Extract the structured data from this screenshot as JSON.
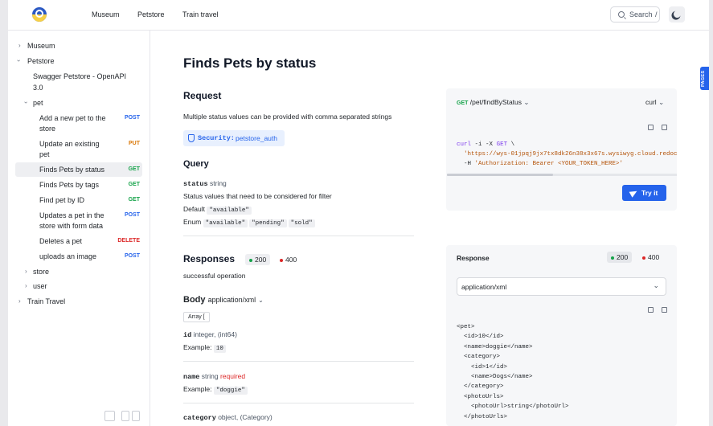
{
  "header": {
    "nav": [
      "Museum",
      "Petstore",
      "Train travel"
    ],
    "search": {
      "label": "Search",
      "shortcut": "/"
    }
  },
  "sidebar": {
    "museum": "Museum",
    "petstore": "Petstore",
    "petstore_doc": [
      "Swagger Petstore - OpenAPI",
      "3.0"
    ],
    "pet": "pet",
    "endpoints": [
      {
        "lines": [
          "Add a new pet to the",
          "store"
        ],
        "method": "POST"
      },
      {
        "lines": [
          "Update an existing",
          "pet"
        ],
        "method": "PUT"
      },
      {
        "lines": [
          "Finds Pets by status"
        ],
        "method": "GET",
        "active": true
      },
      {
        "lines": [
          "Finds Pets by tags"
        ],
        "method": "GET"
      },
      {
        "lines": [
          "Find pet by ID"
        ],
        "method": "GET"
      },
      {
        "lines": [
          "Updates a pet in the",
          "store with form data"
        ],
        "method": "POST"
      },
      {
        "lines": [
          "Deletes a pet"
        ],
        "method": "DELETE"
      },
      {
        "lines": [
          "uploads an image"
        ],
        "method": "POST"
      }
    ],
    "store": "store",
    "user": "user",
    "train_travel": "Train Travel"
  },
  "main": {
    "title": "Finds Pets by status",
    "request": {
      "heading": "Request",
      "description": "Multiple status values can be provided with comma separated strings",
      "security_label": "Security:",
      "security_value": "petstore_auth"
    },
    "query": {
      "heading": "Query",
      "param_name": "status",
      "param_type": "string",
      "param_desc": "Status values that need to be considered for filter",
      "default_label": "Default",
      "default_value": "\"available\"",
      "enum_label": "Enum",
      "enum_values": [
        "\"available\"",
        "\"pending\"",
        "\"sold\""
      ]
    },
    "responses": {
      "heading": "Responses",
      "codes": [
        "200",
        "400"
      ],
      "description": "successful operation",
      "body_label": "Body",
      "body_type": "application/xml",
      "array_label": "Array [",
      "fields": [
        {
          "name": "id",
          "type": "integer, (int64)",
          "required": "",
          "example_label": "Example:",
          "example": "10"
        },
        {
          "name": "name",
          "type": "string",
          "required": "required",
          "example_label": "Example:",
          "example": "\"doggie\""
        },
        {
          "name": "category",
          "type": "object, (Category)",
          "required": "",
          "example_label": "",
          "example": ""
        }
      ]
    }
  },
  "request_panel": {
    "method": "GET",
    "path": "/pet/findByStatus",
    "lang": "curl",
    "code": {
      "cmd": "curl",
      "flags1": "-i -X",
      "verb": "GET",
      "cont": "\\",
      "url": "'https://wys-01jpqj9jx7tx8dk26n38x3x67s.wysiwyg.cloud.redoc",
      "h_flag": "-H",
      "header": "'Authorization: Bearer <YOUR_TOKEN_HERE>'"
    },
    "try_label": "Try it"
  },
  "response_panel": {
    "title": "Response",
    "codes": [
      "200",
      "400"
    ],
    "content_type": "application/xml",
    "xml": [
      "<pet>",
      "  <id>10</id>",
      "  <name>doggie</name>",
      "  <category>",
      "    <id>1</id>",
      "    <name>Dogs</name>",
      "  </category>",
      "  <photoUrls>",
      "    <photoUrl>string</photoUrl>",
      "  </photoUrls>"
    ]
  },
  "pages_tab": "PAGES",
  "colors": {
    "accent": "#2563eb",
    "get": "#16a34a",
    "post": "#2563eb",
    "put": "#d97706",
    "delete": "#dc2626",
    "required": "#dc2626"
  }
}
